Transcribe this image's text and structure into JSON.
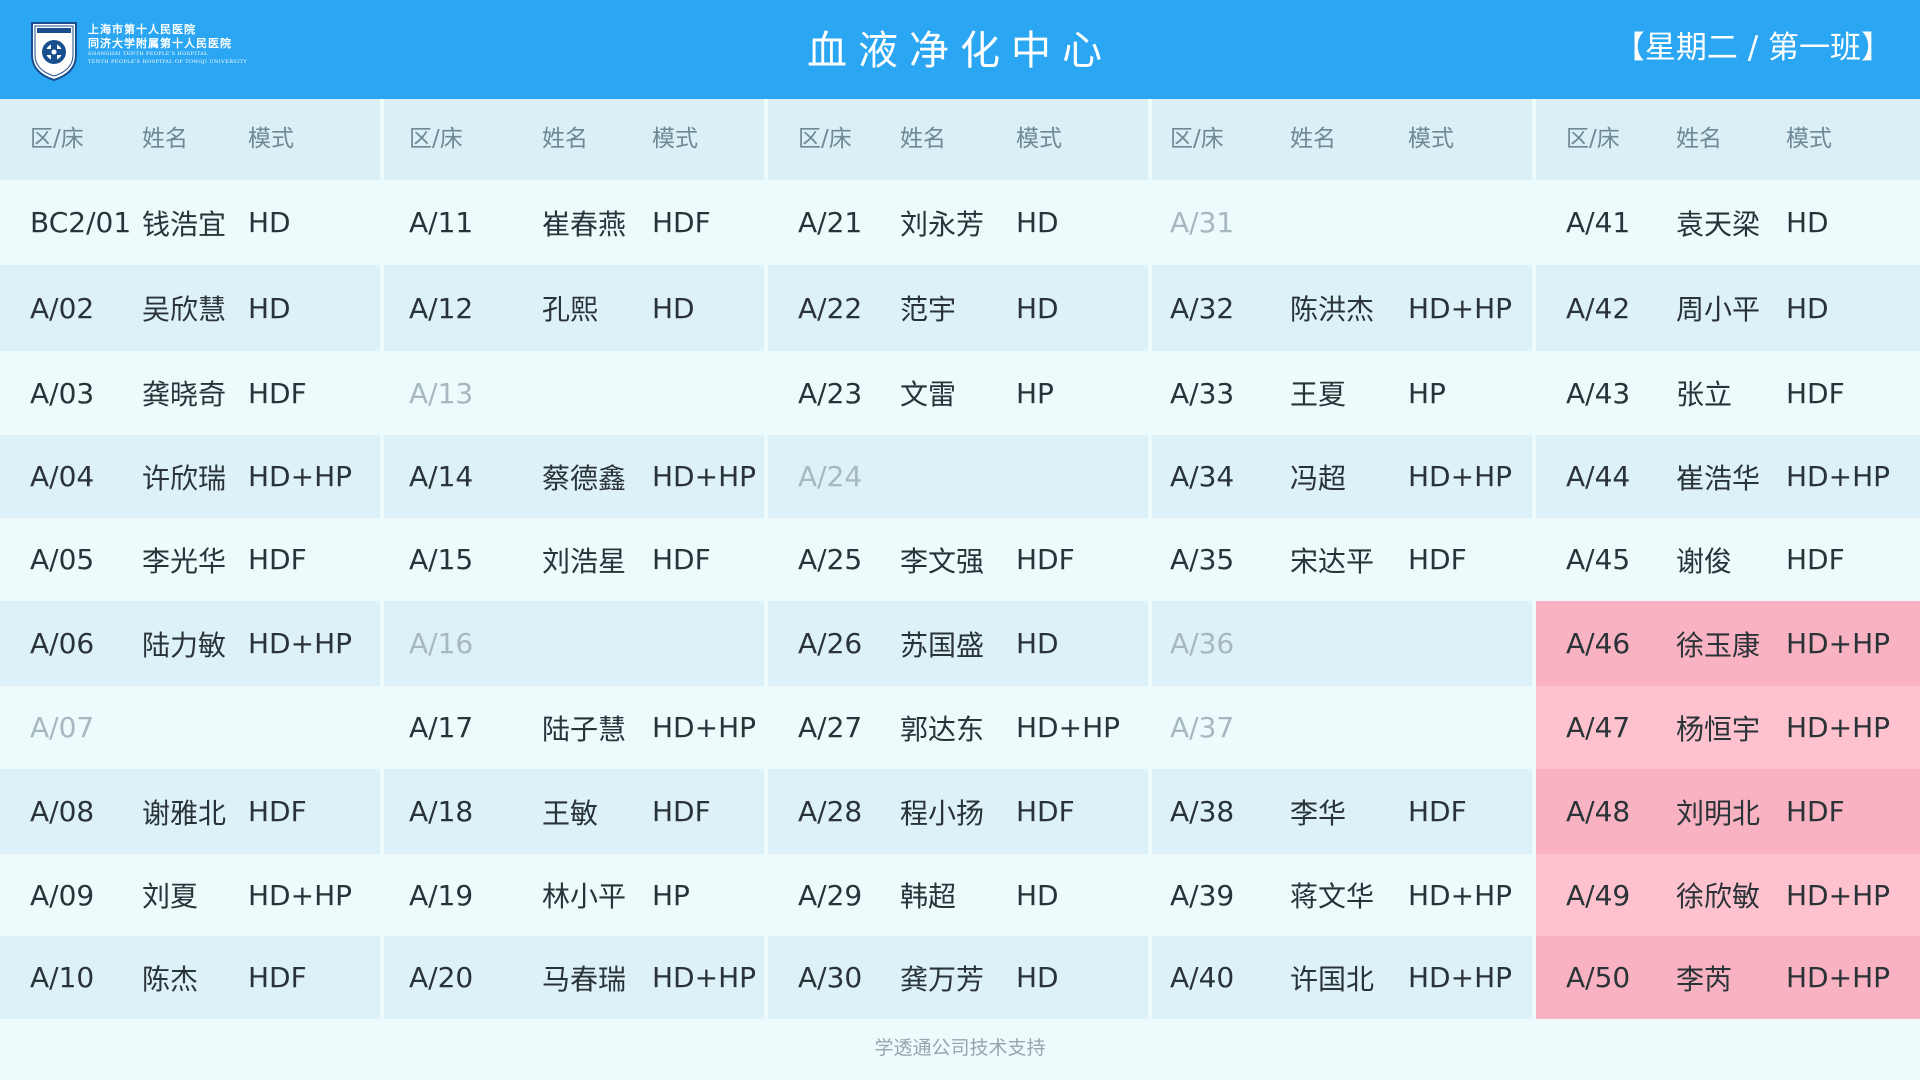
{
  "header": {
    "logo": {
      "line1": "上海市第十人民医院",
      "line2": "同济大学附属第十人民医院",
      "line3": "SHANGHAI TENTH PEOPLE'S HOSPITAL",
      "line4": "TENTH PEOPLE'S HOSPITAL OF TONGJI UNIVERSITY",
      "seal_text": "上海市第十人民医院"
    },
    "title": "血液净化中心",
    "schedule": "【星期二 / 第一班】"
  },
  "columns_header": {
    "bed": "区/床",
    "name": "姓名",
    "mode": "模式"
  },
  "colors": {
    "header_bg": "#2aa6f2",
    "highlight_row": "#fdc2cd",
    "highlight_row_alt": "#f8b2c1"
  },
  "groups": [
    {
      "rows": [
        {
          "bed": "BC2/01",
          "name": "钱浩宜",
          "mode": "HD"
        },
        {
          "bed": "A/02",
          "name": "吴欣慧",
          "mode": "HD"
        },
        {
          "bed": "A/03",
          "name": "龚晓奇",
          "mode": "HDF"
        },
        {
          "bed": "A/04",
          "name": "许欣瑞",
          "mode": "HD+HP"
        },
        {
          "bed": "A/05",
          "name": "李光华",
          "mode": "HDF"
        },
        {
          "bed": "A/06",
          "name": "陆力敏",
          "mode": "HD+HP"
        },
        {
          "bed": "A/07",
          "name": "",
          "mode": ""
        },
        {
          "bed": "A/08",
          "name": "谢雅北",
          "mode": "HDF"
        },
        {
          "bed": "A/09",
          "name": "刘夏",
          "mode": "HD+HP"
        },
        {
          "bed": "A/10",
          "name": "陈杰",
          "mode": "HDF"
        }
      ]
    },
    {
      "rows": [
        {
          "bed": "A/11",
          "name": "崔春燕",
          "mode": "HDF"
        },
        {
          "bed": "A/12",
          "name": "孔熙",
          "mode": "HD"
        },
        {
          "bed": "A/13",
          "name": "",
          "mode": ""
        },
        {
          "bed": "A/14",
          "name": "蔡德鑫",
          "mode": "HD+HP"
        },
        {
          "bed": "A/15",
          "name": "刘浩星",
          "mode": "HDF"
        },
        {
          "bed": "A/16",
          "name": "",
          "mode": ""
        },
        {
          "bed": "A/17",
          "name": "陆子慧",
          "mode": "HD+HP"
        },
        {
          "bed": "A/18",
          "name": "王敏",
          "mode": "HDF"
        },
        {
          "bed": "A/19",
          "name": "林小平",
          "mode": "HP"
        },
        {
          "bed": "A/20",
          "name": "马春瑞",
          "mode": "HD+HP"
        }
      ]
    },
    {
      "rows": [
        {
          "bed": "A/21",
          "name": "刘永芳",
          "mode": "HD"
        },
        {
          "bed": "A/22",
          "name": "范宇",
          "mode": "HD"
        },
        {
          "bed": "A/23",
          "name": "文雷",
          "mode": "HP"
        },
        {
          "bed": "A/24",
          "name": "",
          "mode": ""
        },
        {
          "bed": "A/25",
          "name": "李文强",
          "mode": "HDF"
        },
        {
          "bed": "A/26",
          "name": "苏国盛",
          "mode": "HD"
        },
        {
          "bed": "A/27",
          "name": "郭达东",
          "mode": "HD+HP"
        },
        {
          "bed": "A/28",
          "name": "程小扬",
          "mode": "HDF"
        },
        {
          "bed": "A/29",
          "name": "韩超",
          "mode": "HD"
        },
        {
          "bed": "A/30",
          "name": "龚万芳",
          "mode": "HD"
        }
      ]
    },
    {
      "rows": [
        {
          "bed": "A/31",
          "name": "",
          "mode": ""
        },
        {
          "bed": "A/32",
          "name": "陈洪杰",
          "mode": "HD+HP"
        },
        {
          "bed": "A/33",
          "name": "王夏",
          "mode": "HP"
        },
        {
          "bed": "A/34",
          "name": "冯超",
          "mode": "HD+HP"
        },
        {
          "bed": "A/35",
          "name": "宋达平",
          "mode": "HDF"
        },
        {
          "bed": "A/36",
          "name": "",
          "mode": ""
        },
        {
          "bed": "A/37",
          "name": "",
          "mode": ""
        },
        {
          "bed": "A/38",
          "name": "李华",
          "mode": "HDF"
        },
        {
          "bed": "A/39",
          "name": "蒋文华",
          "mode": "HD+HP"
        },
        {
          "bed": "A/40",
          "name": "许国北",
          "mode": "HD+HP"
        }
      ]
    },
    {
      "rows": [
        {
          "bed": "A/41",
          "name": "袁天梁",
          "mode": "HD"
        },
        {
          "bed": "A/42",
          "name": "周小平",
          "mode": "HD"
        },
        {
          "bed": "A/43",
          "name": "张立",
          "mode": "HDF"
        },
        {
          "bed": "A/44",
          "name": "崔浩华",
          "mode": "HD+HP"
        },
        {
          "bed": "A/45",
          "name": "谢俊",
          "mode": "HDF"
        },
        {
          "bed": "A/46",
          "name": "徐玉康",
          "mode": "HD+HP",
          "highlight": true
        },
        {
          "bed": "A/47",
          "name": "杨恒宇",
          "mode": "HD+HP",
          "highlight": true
        },
        {
          "bed": "A/48",
          "name": "刘明北",
          "mode": "HDF",
          "highlight": true
        },
        {
          "bed": "A/49",
          "name": "徐欣敏",
          "mode": "HD+HP",
          "highlight": true
        },
        {
          "bed": "A/50",
          "name": "李芮",
          "mode": "HD+HP",
          "highlight": true
        }
      ]
    }
  ],
  "footer": "学透通公司技术支持"
}
